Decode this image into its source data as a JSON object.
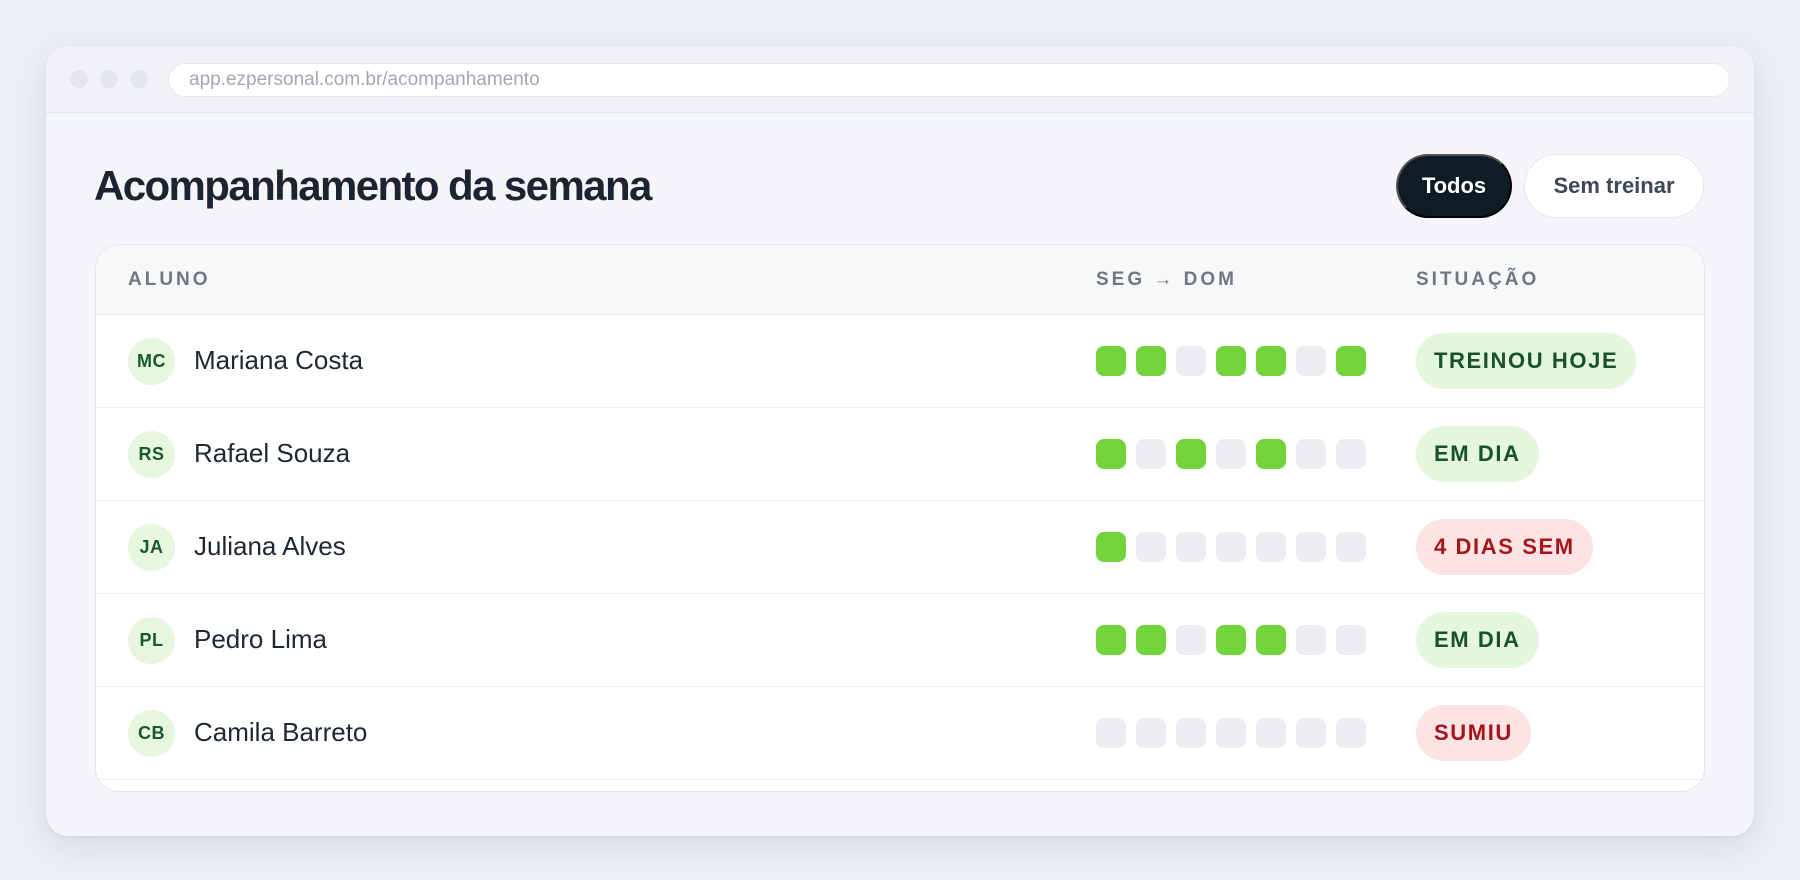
{
  "browser": {
    "url": "app.ezpersonal.com.br/acompanhamento"
  },
  "page": {
    "title": "Acompanhamento da semana"
  },
  "filters": {
    "todos": "Todos",
    "sem_treinar": "Sem treinar",
    "active": "todos"
  },
  "table": {
    "headers": {
      "aluno": "ALUNO",
      "semana": "SEG → DOM",
      "situacao": "SITUAÇÃO"
    },
    "rows": [
      {
        "initials": "MC",
        "name": "Mariana Costa",
        "days": [
          1,
          1,
          0,
          1,
          1,
          0,
          1
        ],
        "status": "TREINOU HOJE",
        "tone": "good"
      },
      {
        "initials": "RS",
        "name": "Rafael Souza",
        "days": [
          1,
          0,
          1,
          0,
          1,
          0,
          0
        ],
        "status": "EM DIA",
        "tone": "good"
      },
      {
        "initials": "JA",
        "name": "Juliana Alves",
        "days": [
          1,
          0,
          0,
          0,
          0,
          0,
          0
        ],
        "status": "4 DIAS SEM",
        "tone": "bad"
      },
      {
        "initials": "PL",
        "name": "Pedro Lima",
        "days": [
          1,
          1,
          0,
          1,
          1,
          0,
          0
        ],
        "status": "EM DIA",
        "tone": "good"
      },
      {
        "initials": "CB",
        "name": "Camila Barreto",
        "days": [
          0,
          0,
          0,
          0,
          0,
          0,
          0
        ],
        "status": "SUMIU",
        "tone": "bad"
      }
    ]
  },
  "colors": {
    "trained_day": "#72d43a",
    "empty_day": "#ececf1",
    "good_badge_bg": "#e4f6dc",
    "good_badge_text": "#17522d",
    "bad_badge_bg": "#fde3e3",
    "bad_badge_text": "#a3161b",
    "primary_button": "#0f1c26"
  }
}
